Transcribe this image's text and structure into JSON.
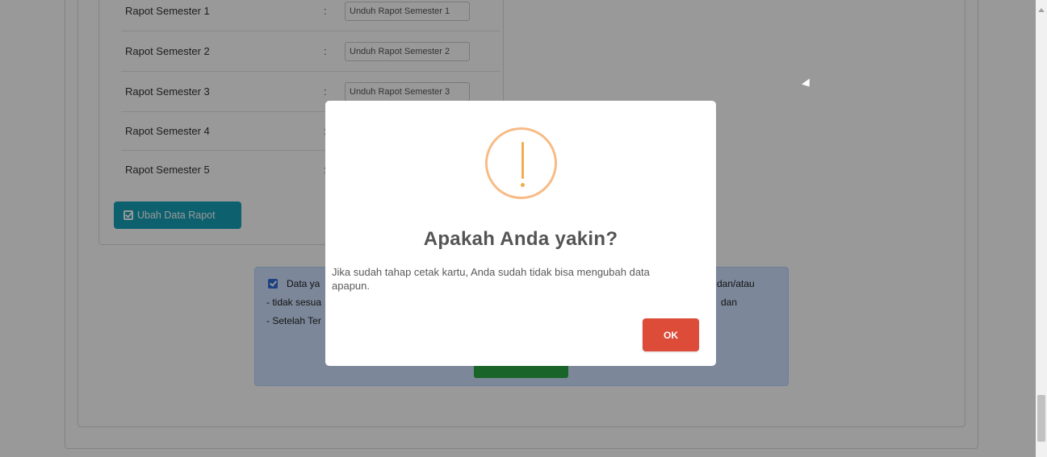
{
  "rapor": {
    "rows": [
      {
        "label": "Rapot Semester 1",
        "colon": ":",
        "input_value": "Unduh Rapot Semester 1"
      },
      {
        "label": "Rapot Semester 2",
        "colon": ":",
        "input_value": "Unduh Rapot Semester 2"
      },
      {
        "label": "Rapot Semester 3",
        "colon": ":",
        "input_value": "Unduh Rapot Semester 3"
      },
      {
        "label": "Rapot Semester 4",
        "colon": ":",
        "input_value": ""
      },
      {
        "label": "Rapot Semester 5",
        "colon": ":",
        "input_value": ""
      }
    ],
    "edit_button_label": "Ubah Data Rapot",
    "edit_button_icon": "edit-checkbox-icon"
  },
  "info": {
    "line1_start": "Data ya",
    "line1_end": "dan/atau",
    "line2_start": "- tidak sesua",
    "line2_end": "dan",
    "line3_start": "- Setelah Ter",
    "check_icon": "checkbox-checked-icon"
  },
  "modal": {
    "icon": "warning-exclamation-icon",
    "title": "Apakah Anda yakin?",
    "text": "Jika sudah tahap cetak kartu, Anda sudah tidak bisa mengubah data apapun.",
    "ok_label": "OK"
  },
  "colors": {
    "overlay": "rgba(0,0,0,0.40)",
    "edit_button": "#17a2b8",
    "info_box": "#cfe2ff",
    "ok_button": "#dd4b39",
    "warning": "#f8bb86"
  }
}
